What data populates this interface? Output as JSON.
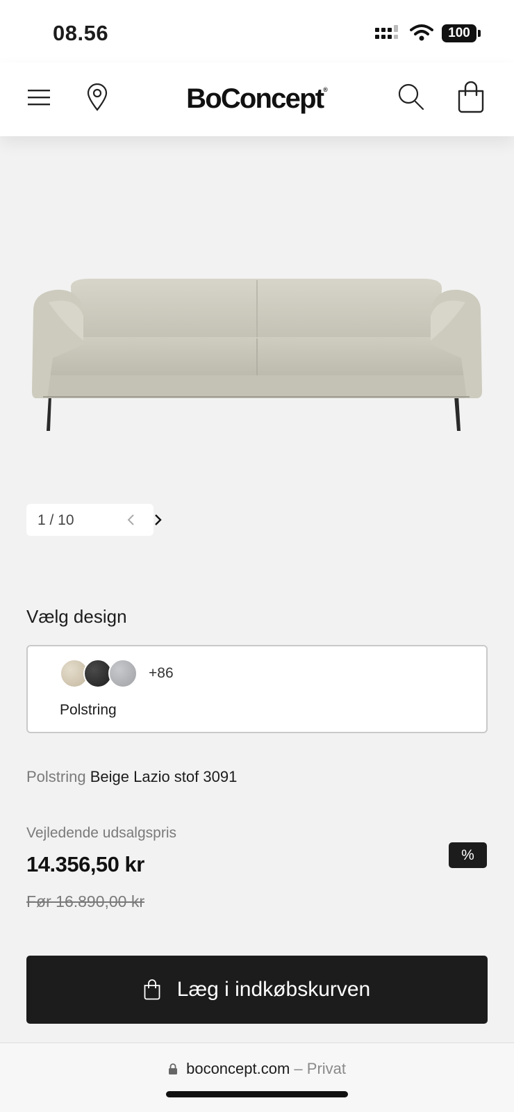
{
  "status_bar": {
    "time": "08.56",
    "battery": "100"
  },
  "header": {
    "logo": "BoConcept",
    "logo_mark": "®"
  },
  "gallery": {
    "counter": "1 / 10"
  },
  "design": {
    "title": "Vælg design",
    "swatches": [
      "beige",
      "black",
      "grey"
    ],
    "more_count": "+86",
    "label": "Polstring"
  },
  "selected": {
    "label": "Polstring",
    "value": "Beige Lazio stof 3091"
  },
  "pricing": {
    "label": "Vejledende udsalgspris",
    "price": "14.356,50 kr",
    "old_price": "Før 16.890,00 kr",
    "badge": "%"
  },
  "cta": {
    "label": "Læg i indkøbskurven"
  },
  "browser": {
    "domain": "boconcept.com",
    "mode": "– Privat"
  },
  "colors": {
    "button_bg": "#1c1c1c",
    "page_bg": "#f2f2f2"
  }
}
